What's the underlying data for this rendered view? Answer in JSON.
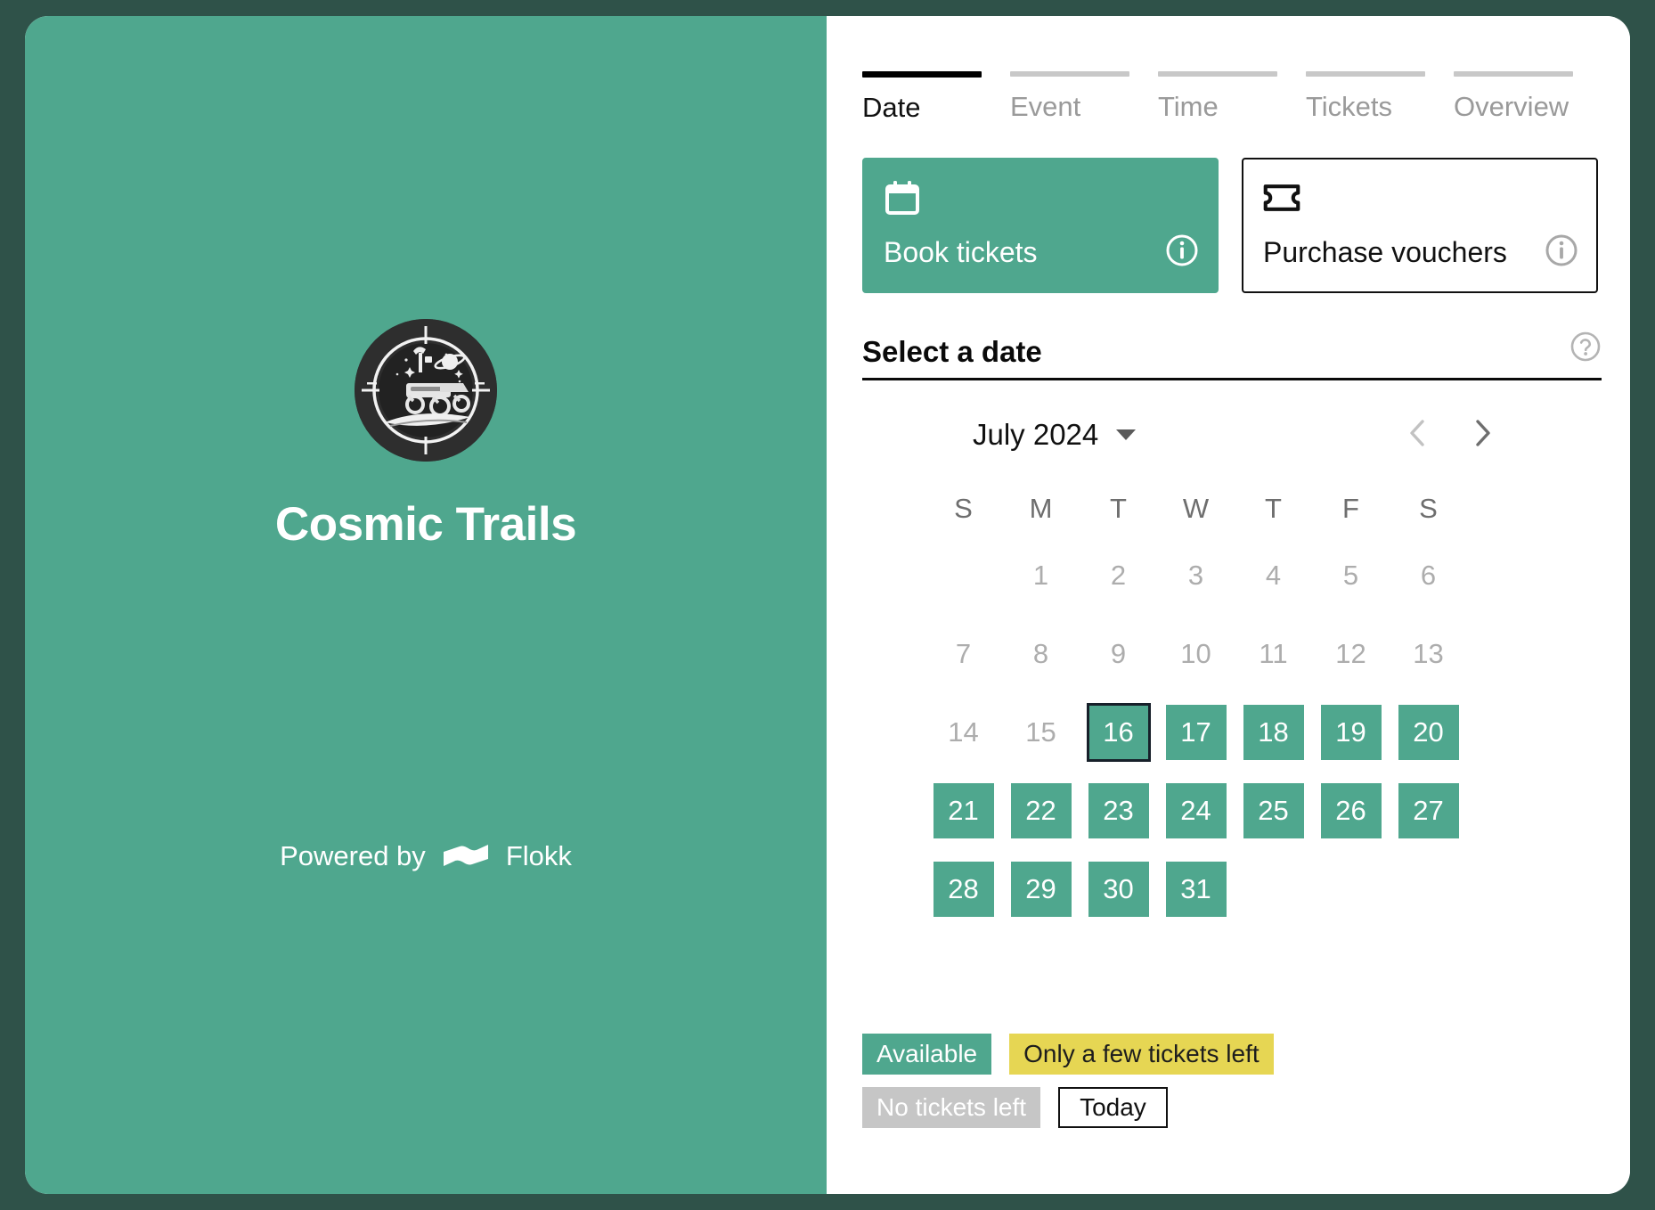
{
  "brand": {
    "name": "Cosmic Trails",
    "logo_icon": "space-rover-badge-icon",
    "powered_by_text": "Powered by",
    "partner_name": "Flokk",
    "partner_logo_icon": "flokk-logo-icon",
    "panel_color": "#4fa78e"
  },
  "page_background": "#2f5249",
  "tabs": [
    {
      "label": "Date",
      "active": true
    },
    {
      "label": "Event",
      "active": false
    },
    {
      "label": "Time",
      "active": false
    },
    {
      "label": "Tickets",
      "active": false
    },
    {
      "label": "Overview",
      "active": false
    }
  ],
  "options": [
    {
      "label": "Book tickets",
      "icon": "calendar-icon",
      "info_icon": "info-circle-icon",
      "selected": true
    },
    {
      "label": "Purchase vouchers",
      "icon": "voucher-ticket-icon",
      "info_icon": "info-circle-icon",
      "selected": false
    }
  ],
  "section": {
    "title": "Select a date",
    "help_icon": "help-circle-icon"
  },
  "calendar": {
    "month_label": "July 2024",
    "dropdown_icon": "chevron-down-icon",
    "prev_icon": "chevron-left-icon",
    "next_icon": "chevron-right-icon",
    "prev_disabled": true,
    "weekdays": [
      "S",
      "M",
      "T",
      "W",
      "T",
      "F",
      "S"
    ],
    "weeks": [
      [
        {
          "day": "",
          "state": "empty"
        },
        {
          "day": "1",
          "state": "disabled"
        },
        {
          "day": "2",
          "state": "disabled"
        },
        {
          "day": "3",
          "state": "disabled"
        },
        {
          "day": "4",
          "state": "disabled"
        },
        {
          "day": "5",
          "state": "disabled"
        },
        {
          "day": "6",
          "state": "disabled"
        }
      ],
      [
        {
          "day": "7",
          "state": "disabled"
        },
        {
          "day": "8",
          "state": "disabled"
        },
        {
          "day": "9",
          "state": "disabled"
        },
        {
          "day": "10",
          "state": "disabled"
        },
        {
          "day": "11",
          "state": "disabled"
        },
        {
          "day": "12",
          "state": "disabled"
        },
        {
          "day": "13",
          "state": "disabled"
        }
      ],
      [
        {
          "day": "14",
          "state": "disabled"
        },
        {
          "day": "15",
          "state": "disabled"
        },
        {
          "day": "16",
          "state": "available",
          "today": true
        },
        {
          "day": "17",
          "state": "available"
        },
        {
          "day": "18",
          "state": "available"
        },
        {
          "day": "19",
          "state": "available"
        },
        {
          "day": "20",
          "state": "available"
        }
      ],
      [
        {
          "day": "21",
          "state": "available"
        },
        {
          "day": "22",
          "state": "available"
        },
        {
          "day": "23",
          "state": "available"
        },
        {
          "day": "24",
          "state": "available"
        },
        {
          "day": "25",
          "state": "available"
        },
        {
          "day": "26",
          "state": "available"
        },
        {
          "day": "27",
          "state": "available"
        }
      ],
      [
        {
          "day": "28",
          "state": "available"
        },
        {
          "day": "29",
          "state": "available"
        },
        {
          "day": "30",
          "state": "available"
        },
        {
          "day": "31",
          "state": "available"
        },
        {
          "day": "",
          "state": "empty"
        },
        {
          "day": "",
          "state": "empty"
        },
        {
          "day": "",
          "state": "empty"
        }
      ]
    ]
  },
  "legend": [
    {
      "label": "Available",
      "style": "available"
    },
    {
      "label": "Only a few tickets left",
      "style": "few"
    },
    {
      "label": "No tickets left",
      "style": "none"
    },
    {
      "label": "Today",
      "style": "today"
    }
  ],
  "colors": {
    "accent_green": "#4fa78e",
    "warning_yellow": "#e6d653",
    "unavailable_gray": "#c6c6c6",
    "dark_background": "#2f5249"
  }
}
